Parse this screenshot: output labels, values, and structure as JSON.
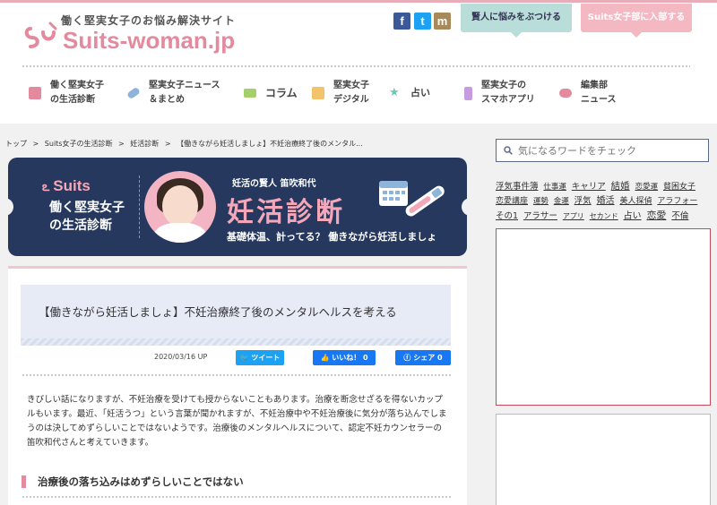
{
  "header": {
    "tagline": "働く堅実女子のお悩み解決サイト",
    "logo": "Suits-woman.jp",
    "social": [
      "f",
      "t",
      "m"
    ],
    "buttons": [
      {
        "label": "賢人に悩みをぶつける",
        "color": "#b9ddd8"
      },
      {
        "label": "Suits女子部に入部する",
        "color": "#f4b8c3"
      }
    ]
  },
  "nav": [
    {
      "label": "働く堅実女子\nの生活診断",
      "icon": "clipboard-icon",
      "color": "#e48a9e"
    },
    {
      "label": "堅実女子ニュース\n＆まとめ",
      "icon": "pill-icon",
      "color": "#8eb5d9"
    },
    {
      "label": "コラム",
      "icon": "book-icon",
      "color": "#a5cf6b"
    },
    {
      "label": "堅実女子\nデジタル",
      "icon": "bag-icon",
      "color": "#f2c36b"
    },
    {
      "label": "占い",
      "icon": "star-icon",
      "color": "#6fc6b8"
    },
    {
      "label": "堅実女子の\nスマホアプリ",
      "icon": "phone-icon",
      "color": "#c79be0"
    },
    {
      "label": "編集部\nニュース",
      "icon": "chat-icon",
      "color": "#e48a9e"
    }
  ],
  "breadcrumb": [
    "トップ",
    ">",
    "Suits女子の生活診断",
    ">",
    "妊活診断",
    ">",
    "【働きながら妊活しましょ】不妊治療終了後のメンタル..."
  ],
  "banner": {
    "brand": "Suits",
    "subtitle": "働く堅実女子\nの生活診断",
    "expert": "妊活の賢人  笛吹和代",
    "title": "妊活診断",
    "tagline": "基礎体温、計ってる？ 働きながら妊活しましょ"
  },
  "article": {
    "title": "【働きながら妊活しましょ】不妊治療終了後のメンタルヘルスを考える",
    "date": "2020/03/16 UP",
    "tweet_label": "ツイート",
    "like_label": "いいね！ 0",
    "share_label": "シェア 0",
    "body": "きびしい話になりますが、不妊治療を受けても授からないこともあります。治療を断念せざるを得ないカップルもいます。最近、「妊活うつ」という言葉が聞かれますが、不妊治療中や不妊治療後に気分が落ち込んでしまうのは決してめずらしいことではないようです。治療後のメンタルヘルスについて、認定不妊カウンセラーの笛吹和代さんと考えていきます。",
    "heading": "治療後の落ち込みはめずらしいことではない"
  },
  "sidebar": {
    "search_placeholder": "気になるワードをチェック",
    "tags": [
      "浮気事件簿",
      "仕事運",
      "キャリア",
      "結婚",
      "恋愛運",
      "貧困女子",
      "恋愛講座",
      "運勢",
      "金運",
      "浮気",
      "婚活",
      "美人探偵",
      "アラフォー",
      "その1",
      "アラサー",
      "アプリ",
      "セカンド",
      "占い",
      "恋愛",
      "不倫"
    ]
  }
}
